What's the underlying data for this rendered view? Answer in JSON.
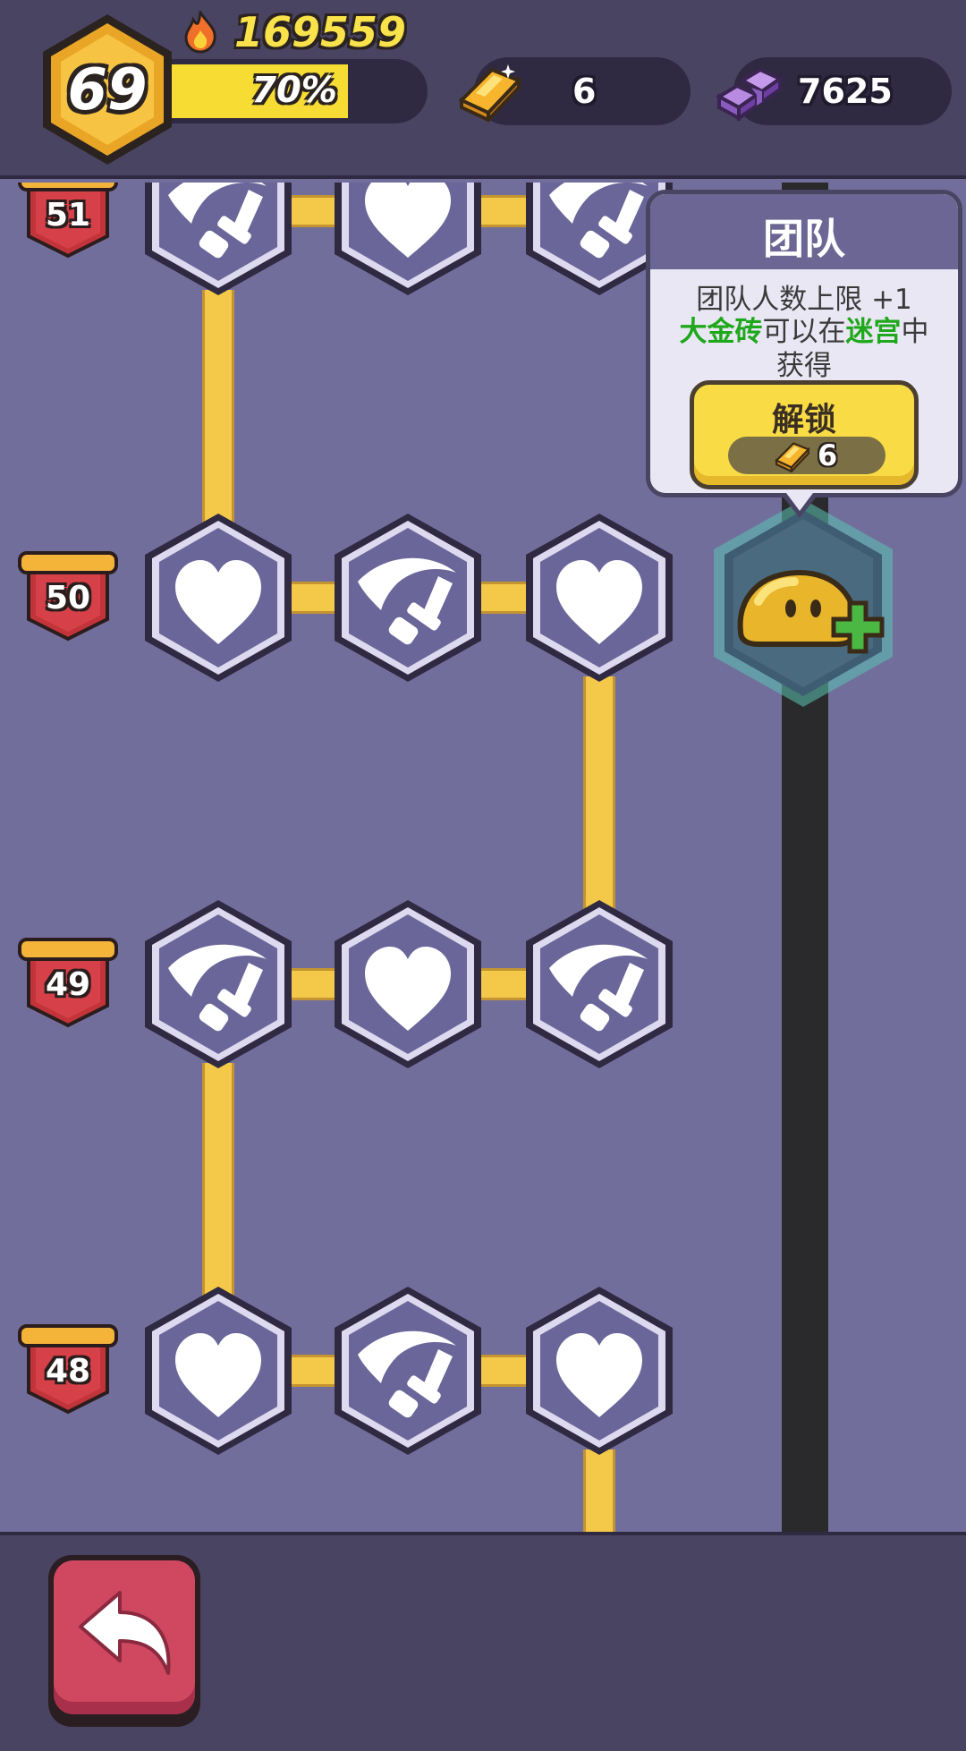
{
  "header": {
    "level": "69",
    "score": "169559",
    "xp_percent_text": "70%",
    "xp_fraction": 0.7,
    "gold_bars": "6",
    "purple_gems": "7625",
    "icons": [
      "hexagon-level-badge",
      "fire-icon",
      "gold-bar-icon",
      "purple-gem-icon"
    ]
  },
  "tree": {
    "rows": [
      {
        "level": "51",
        "nodes": [
          "attack",
          "health",
          "attack"
        ]
      },
      {
        "level": "50",
        "nodes": [
          "health",
          "attack",
          "health"
        ]
      },
      {
        "level": "49",
        "nodes": [
          "attack",
          "health",
          "attack"
        ]
      },
      {
        "level": "48",
        "nodes": [
          "health",
          "attack",
          "health"
        ]
      }
    ],
    "special_node": {
      "icon": "slime-team-plus-icon",
      "badge": "up-arrow-icon"
    }
  },
  "popup": {
    "title": "团队",
    "line1": "团队人数上限 +1",
    "line2_a": "大金砖",
    "line2_b": "可以在",
    "line2_c": "迷宫",
    "line2_d": "中",
    "line3": "获得",
    "unlock_label": "解锁",
    "unlock_cost": "6"
  },
  "colors": {
    "background": "#726e9b",
    "bar": "#4a4463",
    "path": "#f4c94a",
    "highlight_green": "#1fa81b",
    "button_red": "#d04760",
    "button_yellow": "#f9dc45"
  },
  "footer": {
    "back_icon": "back-arrow-icon"
  }
}
